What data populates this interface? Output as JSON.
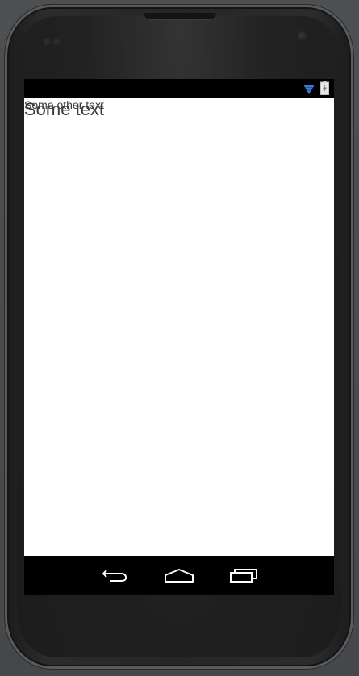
{
  "device": {
    "model": "android-phone-emulator"
  },
  "status_bar": {
    "icons": [
      "wifi-icon",
      "battery-charging-icon"
    ],
    "accent_color": "#3a7bd5"
  },
  "content": {
    "large_text": "Some text",
    "small_text": "Some other text"
  },
  "nav_bar": {
    "buttons": [
      "back-icon",
      "home-icon",
      "recents-icon"
    ]
  }
}
